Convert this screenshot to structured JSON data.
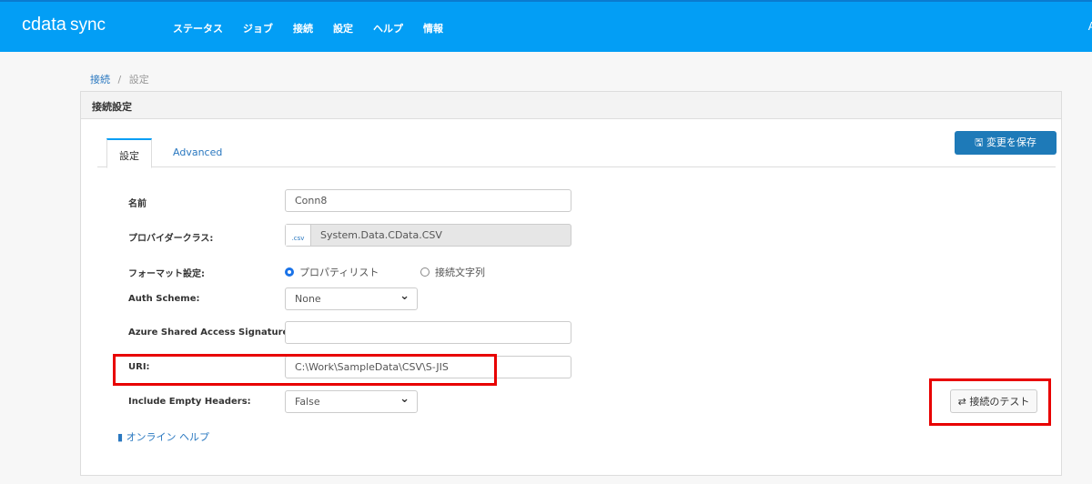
{
  "header": {
    "logo": "cdata",
    "logo_sync": "sync",
    "nav": [
      "ステータス",
      "ジョブ",
      "接続",
      "設定",
      "ヘルプ",
      "情報"
    ],
    "right_clipped": "A"
  },
  "breadcrumb": {
    "parent": "接続",
    "sep": "/",
    "current": "設定"
  },
  "panel": {
    "title": "接続設定"
  },
  "tabs": [
    "設定",
    "Advanced"
  ],
  "save_label": "変更を保存",
  "form": {
    "name_label": "名前",
    "name_value": "Conn8",
    "provider_label": "プロバイダークラス:",
    "provider_icon": ".csv",
    "provider_value": "System.Data.CData.CSV",
    "format_label": "フォーマット設定:",
    "format_opt1": "プロパティリスト",
    "format_opt2": "接続文字列",
    "auth_label": "Auth Scheme:",
    "auth_value": "None",
    "azure_label": "Azure Shared Access Signature:",
    "azure_value": "",
    "uri_label": "URI:",
    "uri_value": "C:\\Work\\SampleData\\CSV\\S-JIS",
    "empty_label": "Include Empty Headers:",
    "empty_value": "False"
  },
  "help_label": "オンライン ヘルプ",
  "test_label": "接続のテスト",
  "colors": {
    "header": "#039ef5",
    "accent": "#1e7ab8",
    "highlight": "#e80000"
  }
}
